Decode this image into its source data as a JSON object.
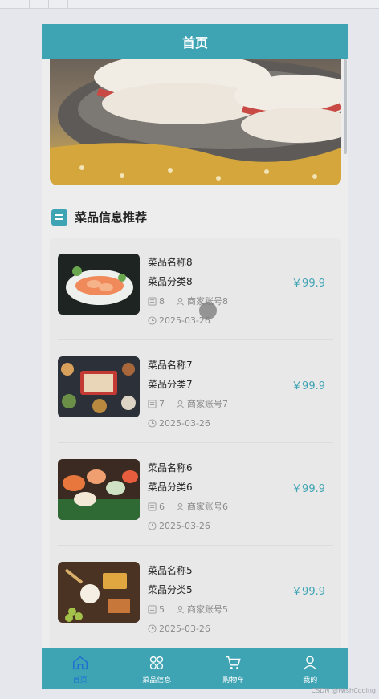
{
  "header": {
    "title": "首页"
  },
  "section": {
    "title": "菜品信息推荐",
    "icon": "list-icon"
  },
  "items": [
    {
      "name": "菜品名称8",
      "category": "菜品分类8",
      "count": "8",
      "merchant": "商家账号8",
      "date": "2025-03-26",
      "price": "￥99.9"
    },
    {
      "name": "菜品名称7",
      "category": "菜品分类7",
      "count": "7",
      "merchant": "商家账号7",
      "date": "2025-03-26",
      "price": "￥99.9"
    },
    {
      "name": "菜品名称6",
      "category": "菜品分类6",
      "count": "6",
      "merchant": "商家账号6",
      "date": "2025-03-26",
      "price": "￥99.9"
    },
    {
      "name": "菜品名称5",
      "category": "菜品分类5",
      "count": "5",
      "merchant": "商家账号5",
      "date": "2025-03-26",
      "price": "￥99.9"
    }
  ],
  "tabs": [
    {
      "label": "首页",
      "icon": "home-icon",
      "active": true
    },
    {
      "label": "菜品信息",
      "icon": "grid-icon",
      "active": false
    },
    {
      "label": "购物车",
      "icon": "cart-icon",
      "active": false
    },
    {
      "label": "我的",
      "icon": "user-icon",
      "active": false
    }
  ],
  "watermark": "CSDN @WishCoding",
  "colors": {
    "primary": "#3ea4b4",
    "active_tab": "#1f6fd1",
    "price": "#3ea4b4"
  }
}
